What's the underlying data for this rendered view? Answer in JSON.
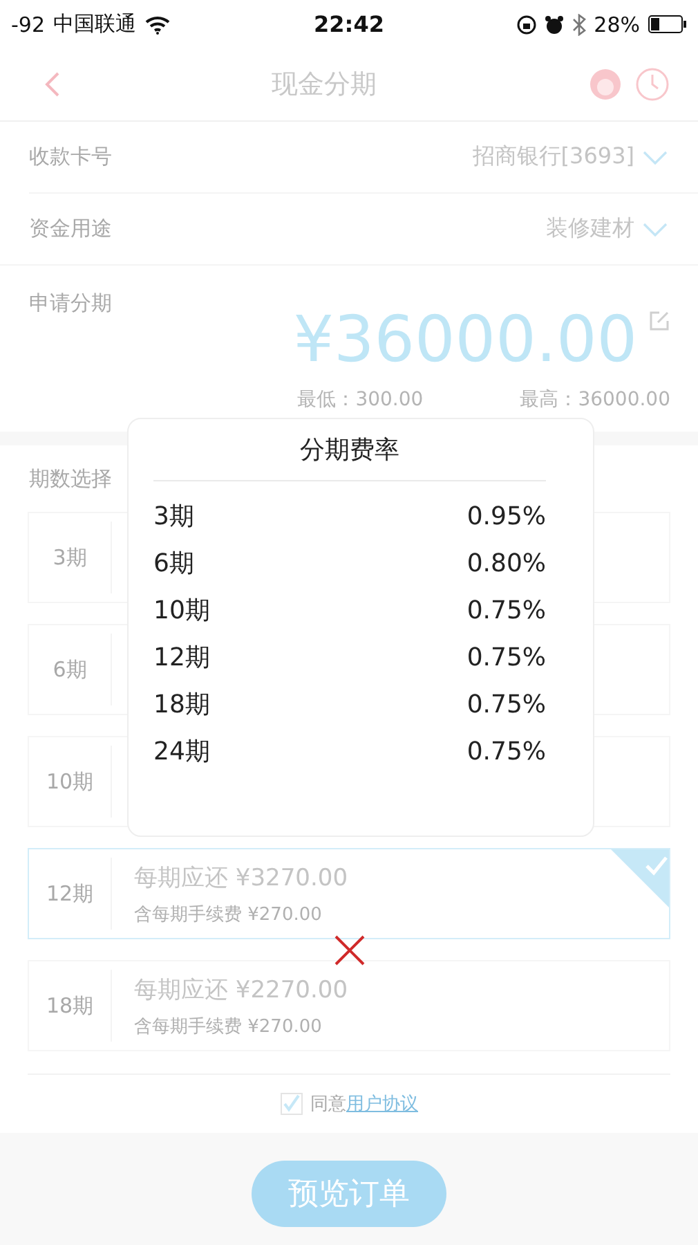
{
  "status_bar": {
    "signal": "-92",
    "carrier": "中国联通",
    "time": "22:42",
    "battery": "28%"
  },
  "nav": {
    "title": "现金分期"
  },
  "form": [
    {
      "label": "收款卡号",
      "value": "招商银行[3693]"
    },
    {
      "label": "资金用途",
      "value": "装修建材"
    }
  ],
  "amount": {
    "label": "申请分期",
    "value": "¥36000.00",
    "min": "最低：300.00",
    "max": "最高：36000.00"
  },
  "term_select": {
    "label": "期数选择"
  },
  "plans": [
    {
      "term": "3期",
      "selected": false
    },
    {
      "term": "6期",
      "selected": false
    },
    {
      "term": "10期",
      "selected": false
    },
    {
      "term": "12期",
      "selected": true,
      "payment": "每期应还 ¥3270.00",
      "fee": "含每期手续费 ¥270.00"
    },
    {
      "term": "18期",
      "selected": false,
      "payment": "每期应还 ¥2270.00",
      "fee": "含每期手续费 ¥270.00"
    }
  ],
  "agreement": {
    "checked": true,
    "text": "同意",
    "link": "用户协议"
  },
  "submit": {
    "label": "预览订单"
  },
  "rate_popup": {
    "title": "分期费率",
    "rates": [
      {
        "term": "3期",
        "rate": "0.95%"
      },
      {
        "term": "6期",
        "rate": "0.80%"
      },
      {
        "term": "10期",
        "rate": "0.75%"
      },
      {
        "term": "12期",
        "rate": "0.75%"
      },
      {
        "term": "18期",
        "rate": "0.75%"
      },
      {
        "term": "24期",
        "rate": "0.75%"
      }
    ]
  }
}
